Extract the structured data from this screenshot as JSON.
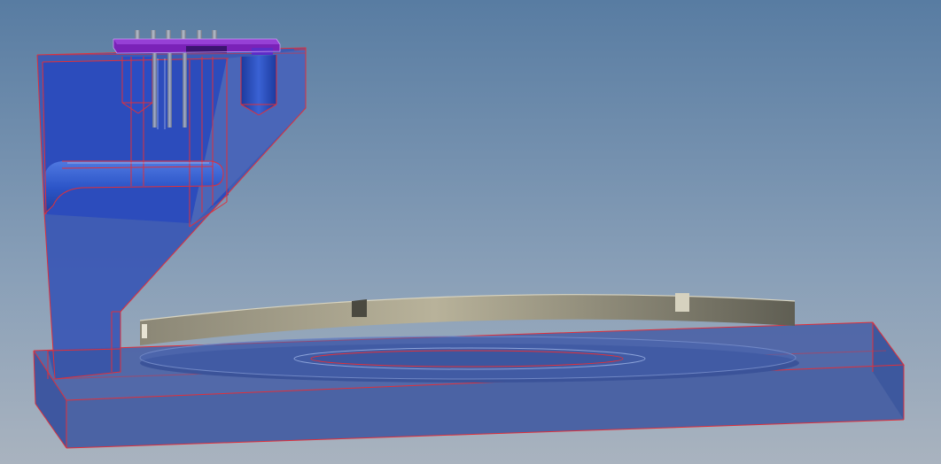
{
  "colors": {
    "bg_top": "#587ca2",
    "bg_bottom": "#a9b3bf",
    "part_fill": "#3d5fb7",
    "part_fill_dark": "#2a4bb0",
    "edge": "#e0303a",
    "disc_light": "#b8b29a",
    "disc_dark": "#5f5e53",
    "pcb": "#7a22b8",
    "pins": "#9aa2ae"
  },
  "icons": {
    "part_icon": "cad-part-icon"
  }
}
